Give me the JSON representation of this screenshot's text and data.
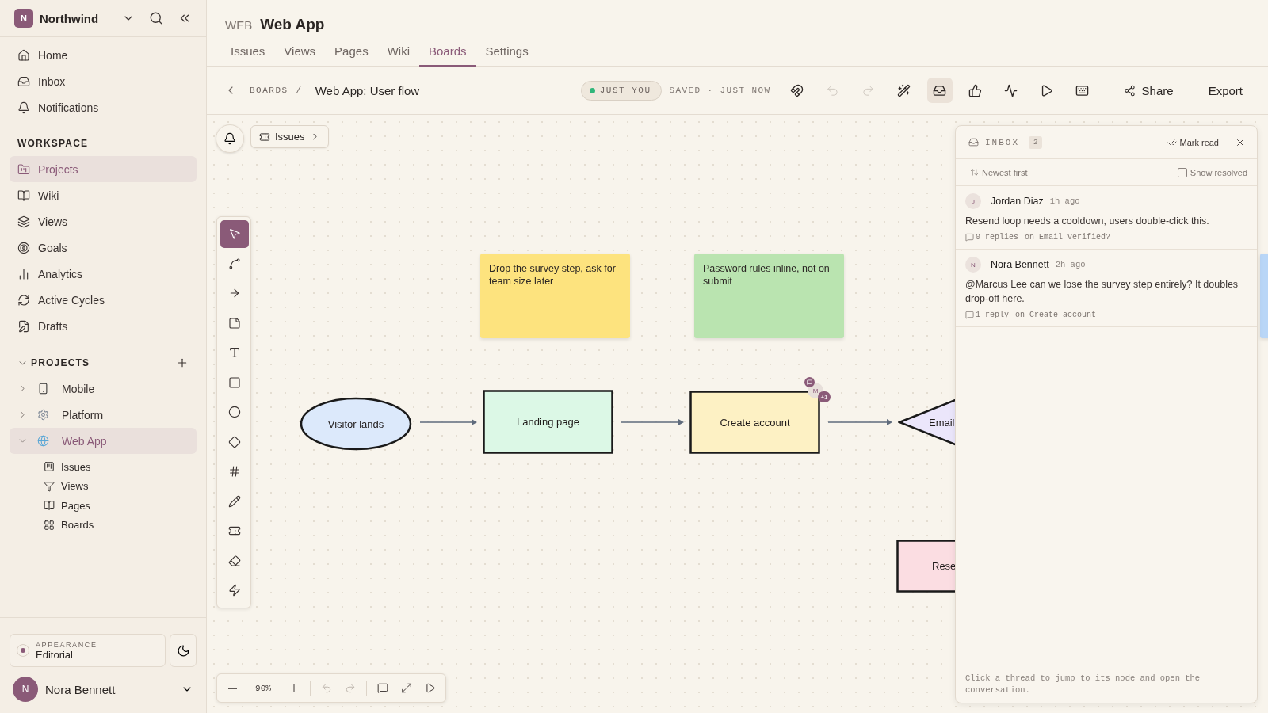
{
  "sidebar": {
    "workspace": {
      "initial": "N",
      "name": "Northwind"
    },
    "nav": [
      {
        "kind": "home",
        "label": "Home"
      },
      {
        "kind": "inbox",
        "label": "Inbox"
      },
      {
        "kind": "bell",
        "label": "Notifications"
      }
    ],
    "workspace_section": {
      "title": "WORKSPACE",
      "items": [
        {
          "kind": "folder",
          "label": "Projects",
          "selected": true
        },
        {
          "kind": "book",
          "label": "Wiki",
          "selected": false
        },
        {
          "kind": "layers",
          "label": "Views",
          "selected": false
        },
        {
          "kind": "target",
          "label": "Goals",
          "selected": false
        },
        {
          "kind": "chart",
          "label": "Analytics",
          "selected": false
        },
        {
          "kind": "cycle",
          "label": "Active Cycles",
          "selected": false
        },
        {
          "kind": "draft",
          "label": "Drafts",
          "selected": false
        }
      ]
    },
    "projects": {
      "title": "PROJECTS",
      "expanded": true,
      "items": [
        {
          "kind": "phone",
          "label": "Mobile",
          "expanded": false,
          "selected": false
        },
        {
          "kind": "gear",
          "label": "Platform",
          "expanded": false,
          "selected": false
        },
        {
          "kind": "globe",
          "label": "Web App",
          "expanded": true,
          "selected": true,
          "children": [
            {
              "kind": "kanban",
              "label": "Issues"
            },
            {
              "kind": "filter",
              "label": "Views"
            },
            {
              "kind": "book",
              "label": "Pages"
            },
            {
              "kind": "grid",
              "label": "Boards"
            }
          ]
        }
      ]
    },
    "appearance": {
      "label": "APPEARANCE",
      "value": "Editorial"
    },
    "user": {
      "initial": "N",
      "name": "Nora Bennett"
    }
  },
  "header": {
    "prefix": "WEB",
    "title": "Web App",
    "tabs": [
      {
        "label": "Issues",
        "selected": false
      },
      {
        "label": "Views",
        "selected": false
      },
      {
        "label": "Pages",
        "selected": false
      },
      {
        "label": "Wiki",
        "selected": false
      },
      {
        "label": "Boards",
        "selected": true
      },
      {
        "label": "Settings",
        "selected": false
      }
    ]
  },
  "toolbar": {
    "breadcrumb": "BOARDS",
    "separator": "/",
    "title": "Web App: User flow",
    "presence": "JUST YOU",
    "saved": "SAVED · JUST NOW",
    "tools": [
      {
        "kind": "magnet",
        "selected": false,
        "disabled": false
      },
      {
        "kind": "undo",
        "selected": false,
        "disabled": true
      },
      {
        "kind": "redo",
        "selected": false,
        "disabled": true
      },
      {
        "kind": "wand",
        "selected": false,
        "disabled": false
      },
      {
        "kind": "inbox",
        "selected": true,
        "disabled": false
      },
      {
        "kind": "thumbs",
        "selected": false,
        "disabled": false
      },
      {
        "kind": "activity",
        "selected": false,
        "disabled": false
      },
      {
        "kind": "play",
        "selected": false,
        "disabled": false
      },
      {
        "kind": "keyboard",
        "selected": false,
        "disabled": false
      }
    ],
    "share": "Share",
    "export": "Export"
  },
  "canvas": {
    "filter": "Issues",
    "tools": [
      {
        "kind": "pointer",
        "selected": true
      },
      {
        "kind": "curve",
        "selected": false
      },
      {
        "kind": "arrow",
        "selected": false
      },
      {
        "kind": "note",
        "selected": false
      },
      {
        "kind": "text",
        "selected": false
      },
      {
        "kind": "square",
        "selected": false
      },
      {
        "kind": "circle",
        "selected": false
      },
      {
        "kind": "diamond",
        "selected": false
      },
      {
        "kind": "frame",
        "selected": false
      },
      {
        "kind": "pencil",
        "selected": false
      },
      {
        "kind": "ticket",
        "selected": false
      },
      {
        "kind": "eraser",
        "selected": false
      },
      {
        "kind": "bolt",
        "selected": false
      }
    ],
    "stickies": [
      {
        "text": "Drop the survey step, ask for team size later",
        "color": "#fde37e"
      },
      {
        "text": "Password rules inline, not on submit",
        "color": "#bae4b0"
      },
      {
        "color": "#b9d6f7"
      }
    ],
    "nodes": [
      {
        "kind": "ellipse",
        "label": "Visitor lands",
        "color": "#dce9fb"
      },
      {
        "kind": "rect",
        "label": "Landing page",
        "color": "#dcf8e6"
      },
      {
        "kind": "rect",
        "label": "Create account",
        "color": "#fdf1c4",
        "presence": {
          "initial": "M",
          "more": "+1"
        }
      },
      {
        "kind": "diamond",
        "label": "Email",
        "color": "#ebe6fb"
      },
      {
        "kind": "rect",
        "label": "Rese",
        "color": "#fbdde2"
      }
    ],
    "zoom": "90%"
  },
  "inbox": {
    "title": "INBOX",
    "count": "2",
    "mark_read": "Mark read",
    "sort": "Newest first",
    "show_resolved": {
      "label": "Show resolved",
      "checked": false
    },
    "threads": [
      {
        "initial": "J",
        "author": "Jordan Diaz",
        "time": "1h ago",
        "text": "Resend loop needs a cooldown, users double-click this.",
        "replies": "0 replies",
        "target": "on Email verified?"
      },
      {
        "initial": "N",
        "author": "Nora Bennett",
        "time": "2h ago",
        "text": "@Marcus Lee can we lose the survey step entirely? It doubles drop-off here.",
        "replies": "1 reply",
        "target": "on Create account"
      }
    ],
    "footer": "Click a thread to jump to its node and open the conversation."
  }
}
